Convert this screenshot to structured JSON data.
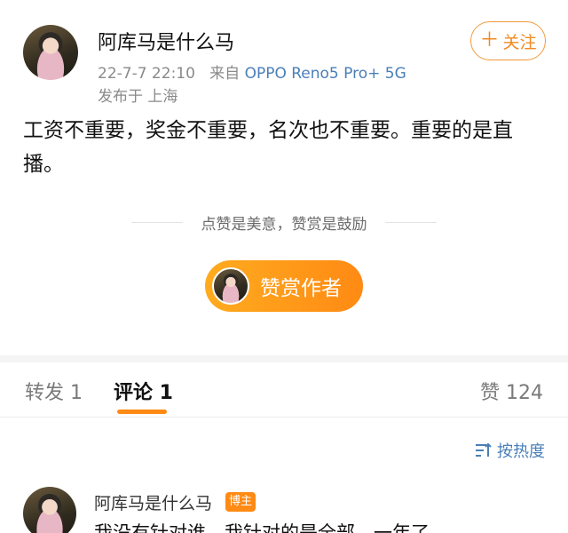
{
  "post": {
    "author": "阿库马是什么马",
    "time": "22-7-7 22:10",
    "from_label": "来自",
    "device": "OPPO Reno5 Pro+ 5G",
    "location": "发布于 上海",
    "follow_label": "关注",
    "follow_icon": "plus-icon",
    "content": "工资不重要，奖金不重要，名次也不重要。重要的是直播。"
  },
  "reward": {
    "tip": "点赞是美意，赞赏是鼓励",
    "button_label": "赞赏作者"
  },
  "tabs": {
    "repost": "转发 1",
    "comment": "评论 1",
    "like": "赞 124",
    "active_color": "#ff8a14"
  },
  "sort": {
    "icon": "sort-icon",
    "label": "按热度"
  },
  "comment": {
    "author": "阿库马是什么马",
    "badge": "博主",
    "text": "我没有针对谁，我针对的是全部。一年了"
  }
}
